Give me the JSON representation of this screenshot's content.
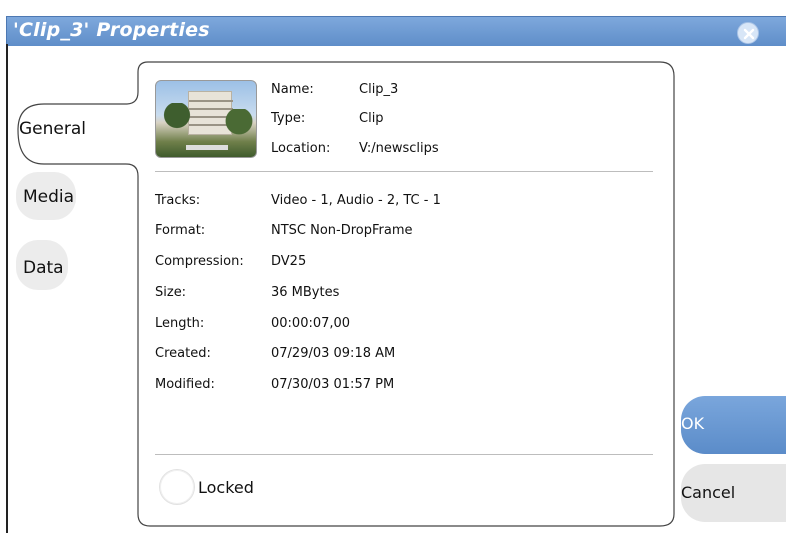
{
  "window": {
    "title": "'Clip_3' Properties"
  },
  "tabs": [
    {
      "label": "General",
      "active": true
    },
    {
      "label": "Media",
      "active": false
    },
    {
      "label": "Data",
      "active": false
    }
  ],
  "header_props": [
    {
      "label": "Name:",
      "value": "Clip_3"
    },
    {
      "label": "Type:",
      "value": "Clip"
    },
    {
      "label": "Location:",
      "value": "V:/newsclips"
    }
  ],
  "props": [
    {
      "label": "Tracks:",
      "value": "Video - 1, Audio - 2, TC - 1"
    },
    {
      "label": "Format:",
      "value": "NTSC Non-DropFrame"
    },
    {
      "label": "Compression:",
      "value": "DV25"
    },
    {
      "label": "Size:",
      "value": "36 MBytes"
    },
    {
      "label": "Length:",
      "value": "00:00:07,00"
    },
    {
      "label": "Created:",
      "value": "07/29/03 09:18 AM"
    },
    {
      "label": "Modified:",
      "value": "07/30/03 01:57 PM"
    }
  ],
  "locked": {
    "label": "Locked",
    "checked": false
  },
  "buttons": {
    "ok": "OK",
    "cancel": "Cancel"
  },
  "icons": {
    "close": "close-icon",
    "thumbnail": "clip-thumbnail"
  },
  "colors": {
    "titlebar": "#6b98d2",
    "ok": "#6a99d3",
    "cancel": "#e6e6e6"
  }
}
